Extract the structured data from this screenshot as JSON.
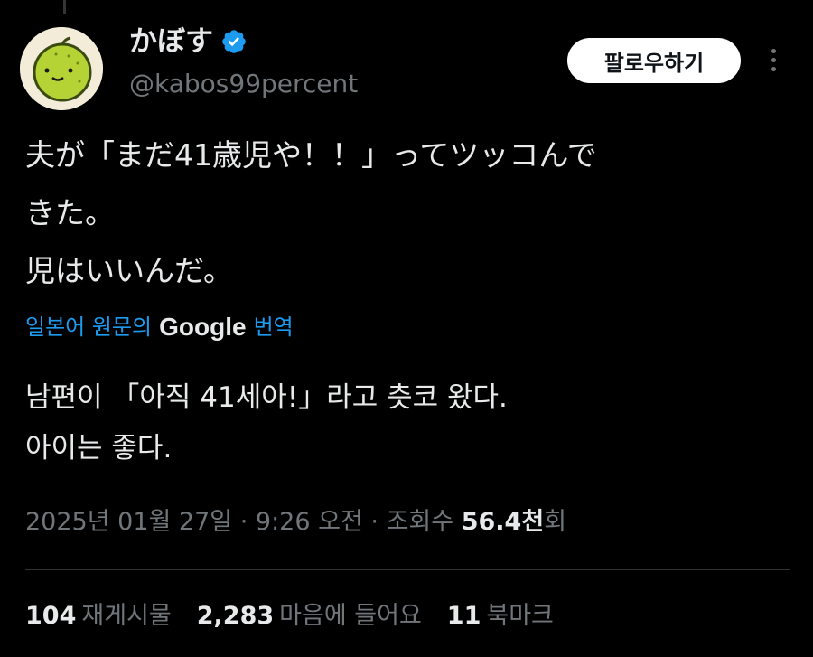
{
  "author": {
    "display_name": "かぼす",
    "handle": "@kabos99percent",
    "avatar_icon": "green-citrus-face-icon",
    "verified_color": "#1d9bf0"
  },
  "follow_label": "팔로우하기",
  "tweet": {
    "lines": [
      "夫が「まだ41歳児や！！」ってツッコんで",
      "きた。",
      "児はいいんだ。"
    ]
  },
  "translation": {
    "prefix": "일본어 원문의",
    "provider": "Google",
    "action": "번역",
    "lines": [
      "남편이 「아직 41세아!」라고 츳코 왔다.",
      "아이는 좋다."
    ]
  },
  "meta": {
    "date": "2025년 01월 27일",
    "separator": "·",
    "time": "9:26 오전",
    "views_label": "조회수",
    "views_value": "56.4천",
    "views_suffix": "회"
  },
  "stats": {
    "reposts_count": "104",
    "reposts_label": "재게시물",
    "likes_count": "2,283",
    "likes_label": "마음에 들어요",
    "bookmarks_count": "11",
    "bookmarks_label": "북마크"
  },
  "colors": {
    "background": "#000000",
    "text": "#e7e9ea",
    "muted": "#71767b",
    "accent": "#1d9bf0"
  }
}
